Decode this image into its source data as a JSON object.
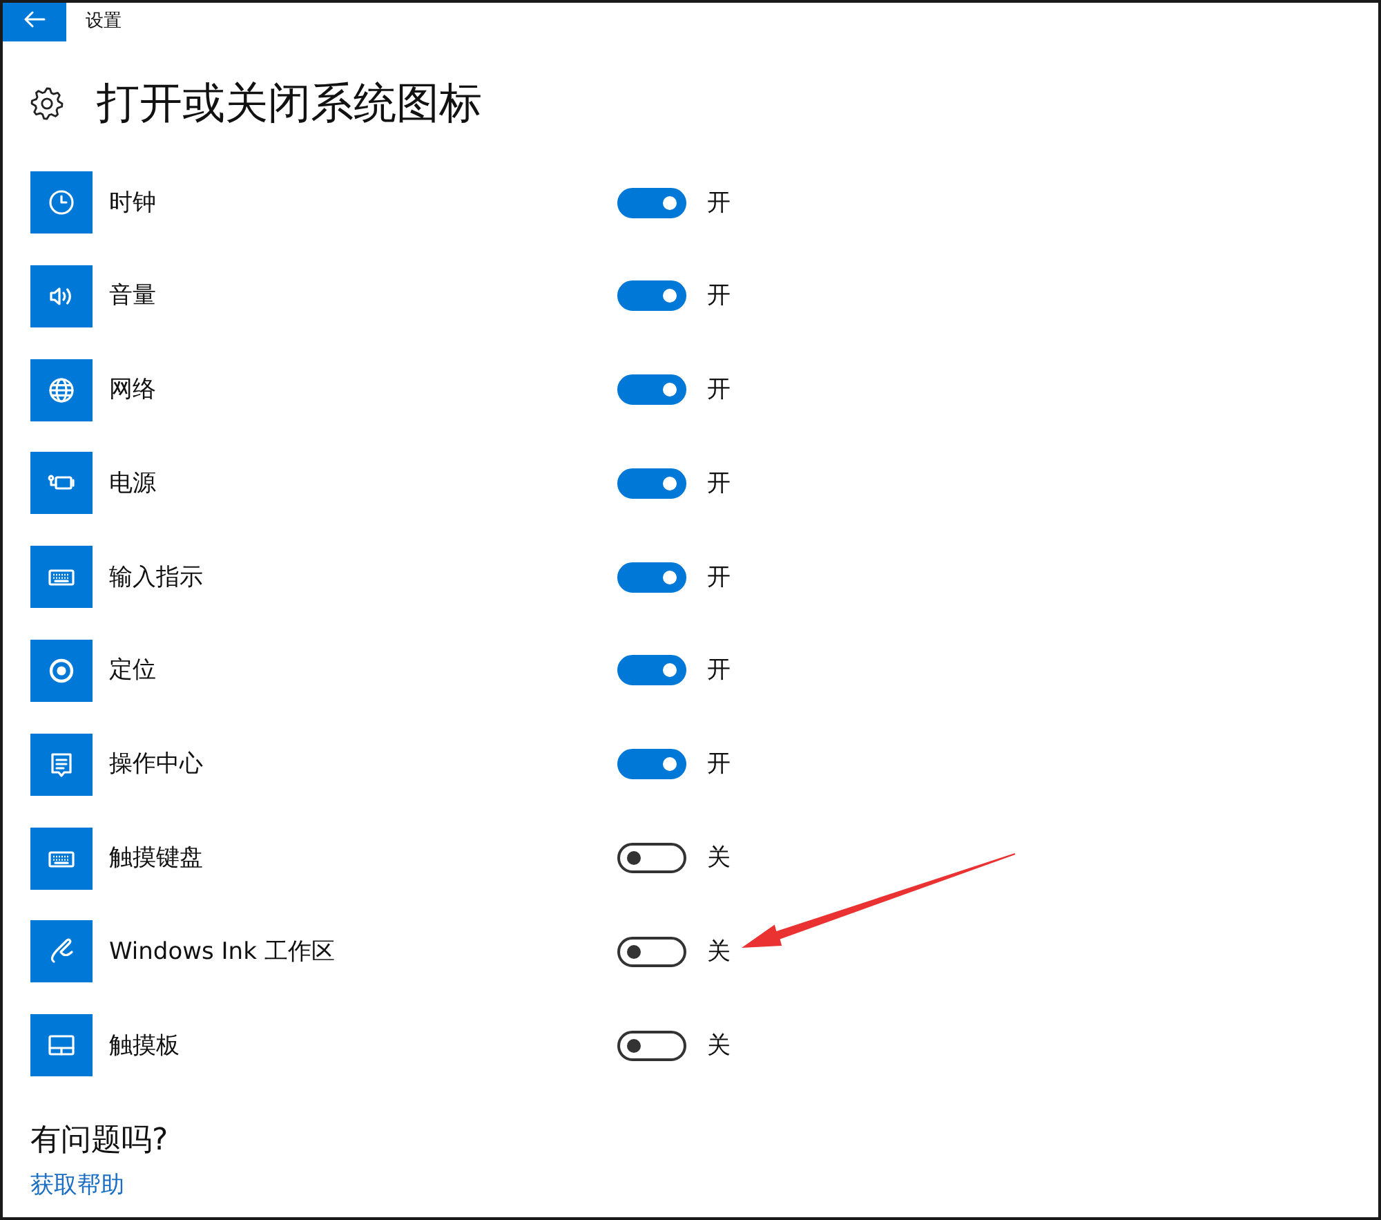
{
  "window": {
    "title": "设置"
  },
  "page": {
    "title": "打开或关闭系统图标"
  },
  "items": [
    {
      "label": "时钟",
      "on": true,
      "state": "开"
    },
    {
      "label": "音量",
      "on": true,
      "state": "开"
    },
    {
      "label": "网络",
      "on": true,
      "state": "开"
    },
    {
      "label": "电源",
      "on": true,
      "state": "开"
    },
    {
      "label": "输入指示",
      "on": true,
      "state": "开"
    },
    {
      "label": "定位",
      "on": true,
      "state": "开"
    },
    {
      "label": "操作中心",
      "on": true,
      "state": "开"
    },
    {
      "label": "触摸键盘",
      "on": false,
      "state": "关"
    },
    {
      "label": "Windows Ink 工作区",
      "on": false,
      "state": "关"
    },
    {
      "label": "触摸板",
      "on": false,
      "state": "关"
    }
  ],
  "help": {
    "heading": "有问题吗?",
    "link": "获取帮助"
  }
}
